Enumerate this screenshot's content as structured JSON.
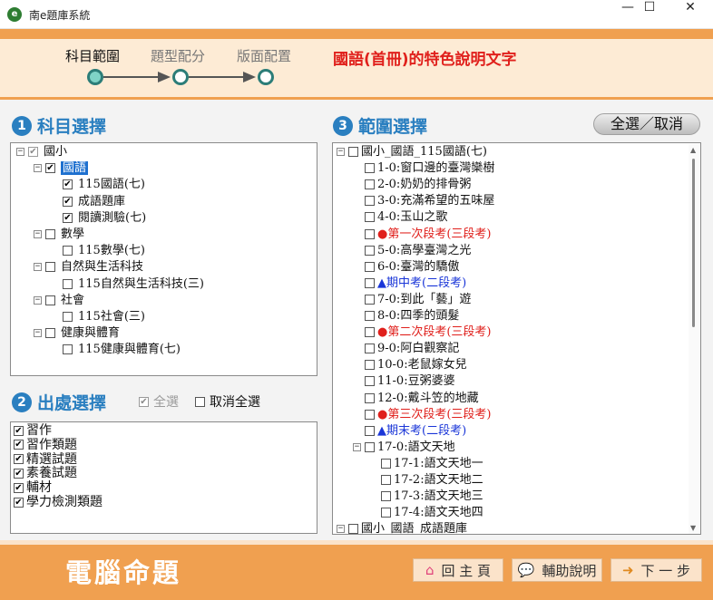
{
  "window": {
    "title": "南e題庫系統",
    "icon_letter": "e",
    "controls": {
      "minimize": "—",
      "maximize": "☐",
      "close": "✕"
    }
  },
  "steps": [
    {
      "label": "科目範圍",
      "active": true
    },
    {
      "label": "題型配分",
      "active": false
    },
    {
      "label": "版面配置",
      "active": false
    }
  ],
  "header_desc": "國語(首冊)的特色說明文字",
  "section1": {
    "num": "1",
    "title": "科目選擇"
  },
  "subject_tree": [
    {
      "exp": "−",
      "check": "✔",
      "label": "國小",
      "grey": true
    },
    {
      "exp": "−",
      "check": "✔",
      "label": "國語",
      "selected": true
    },
    {
      "exp": "",
      "check": "✔",
      "label": "115國語(七)"
    },
    {
      "exp": "",
      "check": "✔",
      "label": "成語題庫"
    },
    {
      "exp": "",
      "check": "✔",
      "label": "閱讀測驗(七)"
    },
    {
      "exp": "−",
      "check": "",
      "label": "數學"
    },
    {
      "exp": "",
      "check": "",
      "label": "115數學(七)"
    },
    {
      "exp": "−",
      "check": "",
      "label": "自然與生活科技"
    },
    {
      "exp": "",
      "check": "",
      "label": "115自然與生活科技(三)"
    },
    {
      "exp": "−",
      "check": "",
      "label": "社會"
    },
    {
      "exp": "",
      "check": "",
      "label": "115社會(三)"
    },
    {
      "exp": "−",
      "check": "",
      "label": "健康與體育"
    },
    {
      "exp": "",
      "check": "",
      "label": "115健康與體育(七)"
    }
  ],
  "section2": {
    "num": "2",
    "title": "出處選擇",
    "select_all": "全選",
    "clear_all": "取消全選"
  },
  "sources": [
    "習作",
    "習作類題",
    "精選試題",
    "素養試題",
    "輔材",
    "學力檢測類題"
  ],
  "section3": {
    "num": "3",
    "title": "範圍選擇",
    "select_all_button": "全選／取消"
  },
  "range_tree": [
    {
      "exp": "−",
      "label": "國小_國語_115國語(七)",
      "style": ""
    },
    {
      "exp": "",
      "label": "1-0:窗口邊的臺灣欒樹",
      "style": ""
    },
    {
      "exp": "",
      "label": "2-0:奶奶的排骨粥",
      "style": ""
    },
    {
      "exp": "",
      "label": "3-0:充滿希望的五味屋",
      "style": ""
    },
    {
      "exp": "",
      "label": "4-0:玉山之歌",
      "style": ""
    },
    {
      "exp": "",
      "mark": "●",
      "label": "第一次段考(三段考)",
      "style": "red"
    },
    {
      "exp": "",
      "label": "5-0:高學臺灣之光",
      "style": ""
    },
    {
      "exp": "",
      "label": "6-0:臺灣的驕傲",
      "style": ""
    },
    {
      "exp": "",
      "mark": "▲",
      "label": "期中考(二段考)",
      "style": "blue"
    },
    {
      "exp": "",
      "label": "7-0:到此「藝」遊",
      "style": ""
    },
    {
      "exp": "",
      "label": "8-0:四季的頭髮",
      "style": ""
    },
    {
      "exp": "",
      "mark": "●",
      "label": "第二次段考(三段考)",
      "style": "red"
    },
    {
      "exp": "",
      "label": "9-0:阿白觀察記",
      "style": ""
    },
    {
      "exp": "",
      "label": "10-0:老鼠嫁女兒",
      "style": ""
    },
    {
      "exp": "",
      "label": "11-0:豆粥婆婆",
      "style": ""
    },
    {
      "exp": "",
      "label": "12-0:戴斗笠的地藏",
      "style": ""
    },
    {
      "exp": "",
      "mark": "●",
      "label": "第三次段考(三段考)",
      "style": "red"
    },
    {
      "exp": "",
      "mark": "▲",
      "label": "期末考(二段考)",
      "style": "blue"
    },
    {
      "exp": "−",
      "label": "17-0:語文天地",
      "style": ""
    },
    {
      "exp": "",
      "label": "17-1:語文天地一",
      "style": ""
    },
    {
      "exp": "",
      "label": "17-2:語文天地二",
      "style": ""
    },
    {
      "exp": "",
      "label": "17-3:語文天地三",
      "style": ""
    },
    {
      "exp": "",
      "label": "17-4:語文天地四",
      "style": ""
    },
    {
      "exp": "−",
      "label": "國小_國語_成語題庫",
      "style": ""
    }
  ],
  "footer": {
    "title": "電腦命題",
    "home_button": "回 主 頁",
    "help_button": "輔助說明",
    "next_button": "下 一 步"
  },
  "colors": {
    "accent_orange": "#f0a050",
    "header_bg": "#fdebd5",
    "section_blue": "#2a7fc0",
    "alert_red": "#e0201c",
    "exam_blue": "#1a36d8"
  }
}
